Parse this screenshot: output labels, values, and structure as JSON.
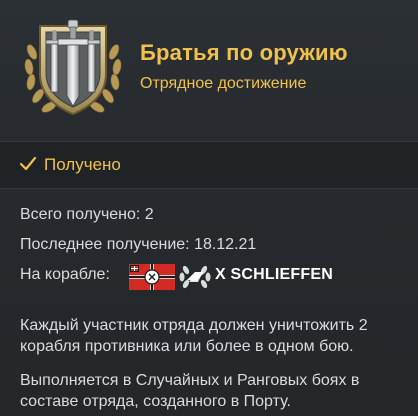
{
  "achievement": {
    "title": "Братья по оружию",
    "subtitle": "Отрядное достижение",
    "emblem_icon": "crossed-swords-laurel-emblem-icon"
  },
  "status": {
    "label": "Получено",
    "icon": "checkmark-icon",
    "accent_color": "#f0c14b"
  },
  "stats": {
    "total_received": "Всего получено: 2",
    "last_received": "Последнее получение: 18.12.21",
    "on_ship_label": "На корабле:",
    "ship_name": "X SCHLIEFFEN",
    "flag_icon": "kriegsmarine-flag-icon",
    "ship_class_icon": "destroyer-class-icon"
  },
  "description": {
    "line1": "Каждый участник отряда должен уничтожить 2 корабля противника или более в одном бою.",
    "line2": "Выполняется в Случайных и Ранговых боях в составе отряда, созданного в Порту."
  }
}
